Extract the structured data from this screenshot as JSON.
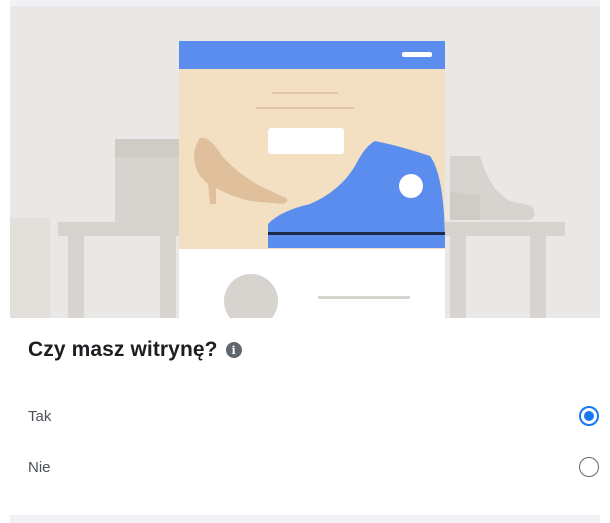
{
  "question": {
    "title": "Czy masz witrynę?",
    "info_icon": "info-icon"
  },
  "options": [
    {
      "label": "Tak",
      "selected": true
    },
    {
      "label": "Nie",
      "selected": false
    }
  ],
  "illustration": {
    "description_icon": "storefront-illustration",
    "accent": "#1877f2",
    "shoe_blue": "#5b8def",
    "panel_beige": "#f3dfc1"
  }
}
